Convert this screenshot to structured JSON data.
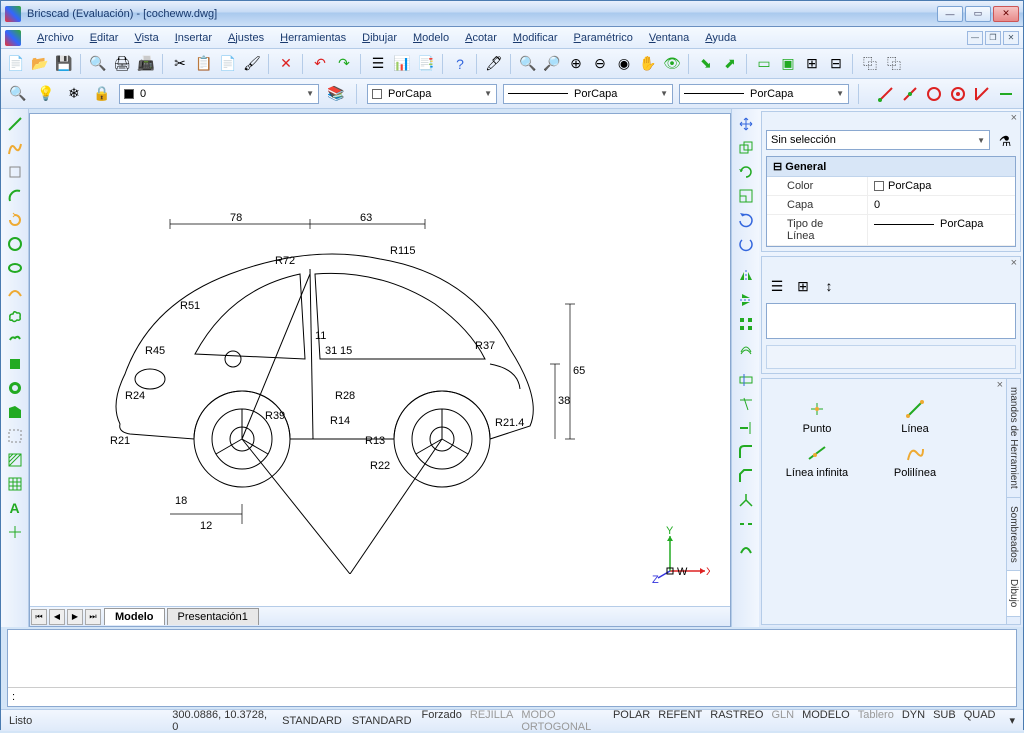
{
  "title": "Bricscad (Evaluación) - [cocheww.dwg]",
  "menu": [
    "Archivo",
    "Editar",
    "Vista",
    "Insertar",
    "Ajustes",
    "Herramientas",
    "Dibujar",
    "Modelo",
    "Acotar",
    "Modificar",
    "Paramétrico",
    "Ventana",
    "Ayuda"
  ],
  "layer_combo": "0",
  "color_combo": "PorCapa",
  "linetype_combo": "PorCapa",
  "lineweight_combo": "PorCapa",
  "selection_combo": "Sin selección",
  "props": {
    "header": "General",
    "rows": [
      {
        "k": "Color",
        "v": "PorCapa"
      },
      {
        "k": "Capa",
        "v": "0"
      },
      {
        "k": "Tipo de Línea",
        "v": "PorCapa"
      }
    ]
  },
  "tabs": {
    "active": "Modelo",
    "inactive": "Presentación1"
  },
  "tools": [
    {
      "name": "Punto"
    },
    {
      "name": "Línea"
    },
    {
      "name": "Línea infinita"
    },
    {
      "name": "Polilínea"
    }
  ],
  "sidetabs": [
    "mandos de Herramient",
    "Sombreados",
    "Dibujo"
  ],
  "status": {
    "ready": "Listo",
    "coords": "300.0886, 10.3728, 0",
    "std1": "STANDARD",
    "std2": "STANDARD",
    "items": [
      "Forzado",
      "REJILLA",
      "MODO ORTOGONAL",
      "POLAR",
      "REFENT",
      "RASTREO",
      "GLN",
      "MODELO",
      "Tablero",
      "DYN",
      "SUB",
      "QUAD"
    ]
  },
  "dims": {
    "d78": "78",
    "d63": "63",
    "r115": "R115",
    "r72": "R72",
    "r51": "R51",
    "r45": "R45",
    "r24": "R24",
    "r21": "R21",
    "r39": "R39",
    "r28": "R28",
    "r14": "R14",
    "r22": "R22",
    "r13": "R13",
    "r37": "R37",
    "r214": "R21.4",
    "d65": "65",
    "d38": "38",
    "d12": "12",
    "d18": "18",
    "d11": "11",
    "d31": "31",
    "d15": "15"
  },
  "axis": {
    "x": "X",
    "y": "Y",
    "z": "Z",
    "w": "W"
  },
  "cmd_prompt": ":"
}
